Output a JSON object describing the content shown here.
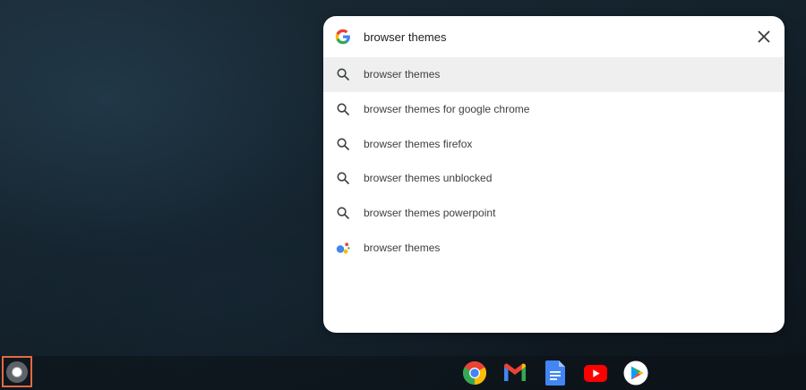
{
  "search": {
    "value": "browser themes"
  },
  "results": [
    {
      "label": "browser themes",
      "icon": "search-icon"
    },
    {
      "label": "browser themes for google chrome",
      "icon": "search-icon"
    },
    {
      "label": "browser themes firefox",
      "icon": "search-icon"
    },
    {
      "label": "browser themes unblocked",
      "icon": "search-icon"
    },
    {
      "label": "browser themes powerpoint",
      "icon": "search-icon"
    },
    {
      "label": "browser themes",
      "icon": "google-assistant-icon"
    }
  ],
  "shelf_apps": [
    {
      "name": "chrome",
      "icon": "chrome-icon"
    },
    {
      "name": "gmail",
      "icon": "gmail-icon"
    },
    {
      "name": "docs",
      "icon": "docs-icon"
    },
    {
      "name": "youtube",
      "icon": "youtube-icon"
    },
    {
      "name": "play-store",
      "icon": "play-store-icon"
    }
  ],
  "colors": {
    "accent_highlight": "#e8683f",
    "selected_row": "#efefef",
    "google_blue": "#4285f4",
    "google_red": "#ea4335",
    "google_yellow": "#fbbc05",
    "google_green": "#34a853"
  }
}
